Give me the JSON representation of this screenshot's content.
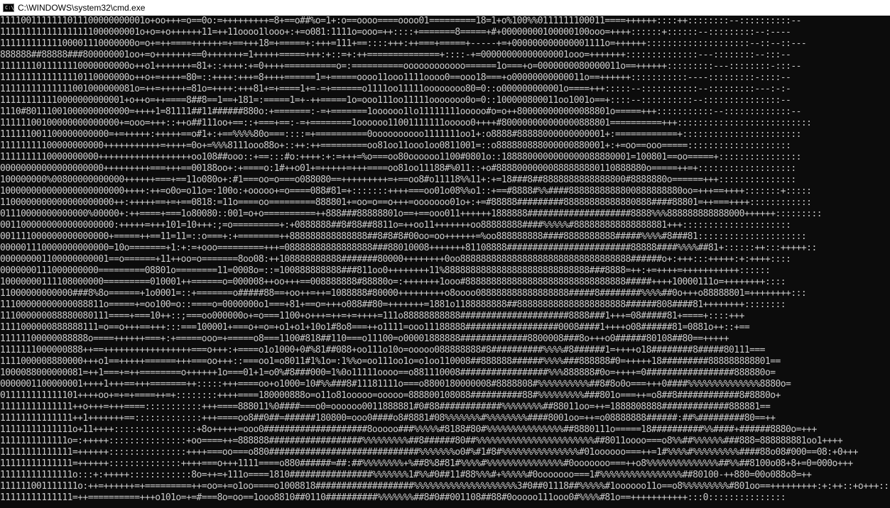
{
  "window": {
    "title": "C:\\WINDOWS\\system32\\cmd.exe",
    "icon_name": "console-icon",
    "icon_glyph": "C:\\"
  },
  "colors": {
    "background": "#0c0c0c",
    "text": "#cccccc",
    "titlebar": "#ffffff"
  },
  "console": {
    "lines": [
      "1111001111111011100000000001o+oo+++=o==0o:=+++++++++=8+==o##%o=1+:o==oooo====oooo01=========18=1+o%100%%0111111100011====++++++::::++::::::::--::::::::::--",
      "111111111111111111000000001o+o=+o++++++11=++11oooo1looo+:+=o081:1111o=ooo=++::::+=======8=====+#+00000000100000100ooo=++++::::::+::::::--:::::::::--:----",
      "11111111111100001110000000o=o+=++====++++++=+==+++18=+=====+:+++=111+==::::+++:++===+=====+-----+=+000000000000001111o=++++++::::::::::::::::::::--::--::---",
      "888888##88888###800000001oo+=o+++++++==0+++++++=1+++++=====+++:+::=+:++==============+::::-+=00000000000000001ooo=+++++++::::::::::::::---::::::::--:::--",
      "1111111011111110000000000o++o1+++++++=81+::++++:+=0++++==========o=:==========oooooooooooo======1o===+o=0000000080000011o==++++++:::::::::---::::::::-:::--",
      "1111111111111110110000000o++o+=++++=80=::++++:+++=8++++======1=+=====oooo11ooo1111oooo0==ooo18===+o00000000000011o==++++++:::::::::::----:::::::::-::::--",
      "11111111111111001000000081o=++=+++++=81o=++++:+++81+=+====1+=-=+======o1111oo11111oooooooo80=0::o000000000001o====+++:::::--:::::::::::--:::::::::---:-:-",
      "111111111110000000000001+o++o=++====8##8==1==+181=:=====1=+-++=====1o=ooo111oo11111ooooooo0o=0::100000800011oo1001o==+::::--::::::::::--:::::::::::::::--",
      "1110#80111001000000000000=++++1=81111##11######880o:+=======:-=+=======1oooooo1lo11111111ooooo#o=o++800000000000088801o=====+++:::::::::::--:::::::::::::--",
      "11111100100000000000000+=ooo=+++::++o##111oo+==::+===+==:-=+========1oooooo11001111111ooooo0++++#800000000000000888801==========+++::::::::::::::::::::::::::",
      "111111001100000000000=+=+++++:+++++==o#1+:+==%%%%80o===::::=+==========0oooooooooo1111111oo1+:o8888#88888000000000001+:============+:::::::::::::::::::::::",
      "11111111100000000000+++++++++++=++++=0o+=%%%8111ooo88o+::++:++=========oo81oo11ooo1oo0811001=::o888880888000000880001+:+=oo==ooo=====::::::::::::::::::::",
      "1111111110000000000++++++++++++++++++oo108##ooo::+==:::#o:++++:+:=+++=%o===oo80oooooo1100#0801o::1888800000000000088880001=100801==oo=====+::::::::::::::::",
      "00000000000000000000+++++++++===+++==00188oo+:+====o:1#++o01+=+++++=+++====oo81oo11188#%011::+o#88880000000888888880110888880o=====++=+:::::::::::::::::::",
      "100000000%00800000000000++++++===+==11o080o+:#1===oo=o===o088080==+++++++++=+==oo8#o11118%%11+:+=18###8##8888888888888800#8888880o======+++:::::::::::::::",
      "100000000000000000000000++++:++=o0o=o11o=:100o:+ooooo+=o====088#81=+:::::::++++===oo01o08%%o1::+==#8888#%%####8888888888800888888880oo=+++==++++:::::::+:::::",
      "1100000000000000000000++:+++++==+=+==0818:=11o====oo=========888801+=oo=o==o+++=ooooooo01o+:+=#88888#########88888888888880888####88801=++===++++::::::::::::",
      "01110000000000000%00000+:++====+===1o80080::001=o+o==========++888###88888801o==+==ooo011++++++1888888####################8888%%%888888888888000++++++:::::::::",
      "0011000000000000000000:+++++=+++101=10+++:;=o=========+:+0888888##8#88##8811o=++oo11+++++++oo88888888####%%%%%#888888888888888881+++:::::::::::::::::::::",
      "001111000000000000000+=====++==11=11=::o===+:+========++888888888888888##8#8#8#00oo=oo++++++=%oo888888888####8888888888#####%%%%#8###81:::::::::::::::::::::",
      "000001110000000000000=10o=======+1:+:=+ooo=========+++=08888888888888888###88010008+++++++81108888########################88888####%%%%##81+::::::++:::+++++::",
      "000000001100000000001==o======+11++oo=o=======8oo08:++108888888888#######80000++++++++0oo888888888888888888888888888888888######o+:+++:::+++++:+:++++::::",
      "0000000111000000000=========08801o========11=0008o=::=100888888888###811oo0++++++++11%8888888888888888888888888888###8888=++:+=++++=+++++++++++::::::",
      "10000000111108000000=========010001++======o=000008++oo+++==008888888#88880o=:+++++++1ooo#8888888888888888888888888888888#####++++10000111o=++++++++::::",
      "11000000000000###8%8o======+1o0001=::+=======o#####88==+oo++=++=1088888#80000+++++++++o8oooo088888888888888888#####8########%%%%##0o+++o88888801=++++++++:::",
      "11100000000000088811o=====+=oo100=o::====o=0000000o1===+81+==o=+++o088##80=+++++++=1881o1188888888##888888888888888888888######808####81++++++++::::::::",
      "111000000088880080111====+===10++::;===oo000000o+=o===1100+o+++=++=+=++++=111o88888888888#####################8888###1+++=08#####81+====+::::+++",
      "1111000000888888111=o==o+++==+++:::===100001+===o+=o=+o1+o1+10o1#8o8===++o1111=ooo11188888##################0008####1++++o08######81=0881o++::+==",
      "11111100000088888o====++++++===+:+=====ooo=+=====o8===1100#818##110===o11100=o00001888888#############8800008###8o+++o0######80108##80==+++++",
      "1111111000000888++==+++++++++++++++++===o+++:+====o1o1000+0#%81##088+oo111o10o=ooooo088888888#8##########%%%%#8######1=++++o18########8#####80111===",
      "1111000008880000+++o1==+++++======+++===oo+++::===oo1=o8011#1%1o=:1%%o=oo111oo1o=o1oo110008##888888######%%%%###888888#0=+++++18#########888888888801==",
      "1000088000000081=++1===+=++========o++++++1o===01+1=o0%#8###000=1%0o11111oooo==o881110008#################%%%888888#0o=++++=0#################888880o=",
      "0000001100000001++++1+++==+++=======++:::::+++====oo+o1000=10#%%###8#11181111o===o8800180000008#8888808#%%%%%%%%%%##8#8o0o===+++0####%%%%%%%%%%%%%%8880o=",
      "011111111111101++++oo+=+=+====++=+::::::::++++====180000888o=o11o81ooooo=ooooo=888800108088##########88#%%%%%%%%%###801o===++=o8##8############8#8880o+",
      "11111111111111++o+++=+++====:::::::::::+++====888011%0####===o0=oooooo0011888881#0#88############%%%%%%%%##88011oo=++=1888808888#############888881==",
      "11111111111111++1+++++++==:::::::::::::+++====oo8##0##=######180800=ooo0####o8#8881#08%%%%%%%#%%%%%%%%####8001oo=++=o08888888######:##%#########80==++",
      "11111111111111o+11++++::::::::::::::::+8o+++++=ooo0####################8ooooo###%%%%%#8188#80#%%%%%%%%%%%%%%%##8880111o=====18##########%%####+######8880o=+++",
      "1111111111111o=:+++++:::::::::::::::+oo====++=888888##################%%%%%%%%%##8######80##%%%%%%%%%%%%%%%%%%%%%%%##8011oooo===o8%%##%%%%%%###888=888888881oo1++++",
      "11111111111111=++++++:::::::::::::::++++===oo===o880#############################%%%%%%%o0#%#1#8#%%%%%%%%%%%%%%%#01oooooo===++=1#%%%%#%%%%%%%%%####88o08#000==08:+0+++",
      "11111111111111=++++++::::::::::::::++++===o+++1111====o880######=##:##%%%%%%%%+%##8%8#81#%%%%#%%%%%%%%%%%%%%%#0ooooooo===++o8%%%%%%%%%%%%%%##%%##8100o08+8+=0=000o+++",
      "11111111111111o:::+:+++++::::::::::::8o=++=+111o====1810################%%%%%%%1#%%#0##11#88%%%#+%%%%%#0ooooooo===1#%%%%%%%%%%%%%%%%##80100-++880=00o088o8=++",
      "111111001111111o:++=++++++=+=========++=oo=+=o1oo====o1008818###################%%%%%%%%%%%%%%%%%%%%3#0##01118##%%%%%#1oooooo11o==o8%%%%%%%%%#801oo==+++++++++:+:++::+o+++::::",
      "11111111111111=++==========+++o101o=+=#===8o=oo==1ooo8810##0110##########%%%%%%%##8#0##001108##88#0ooooo111ooo0#%%%%#81o==+++++++++++:::0:::::::::::::::"
    ]
  }
}
